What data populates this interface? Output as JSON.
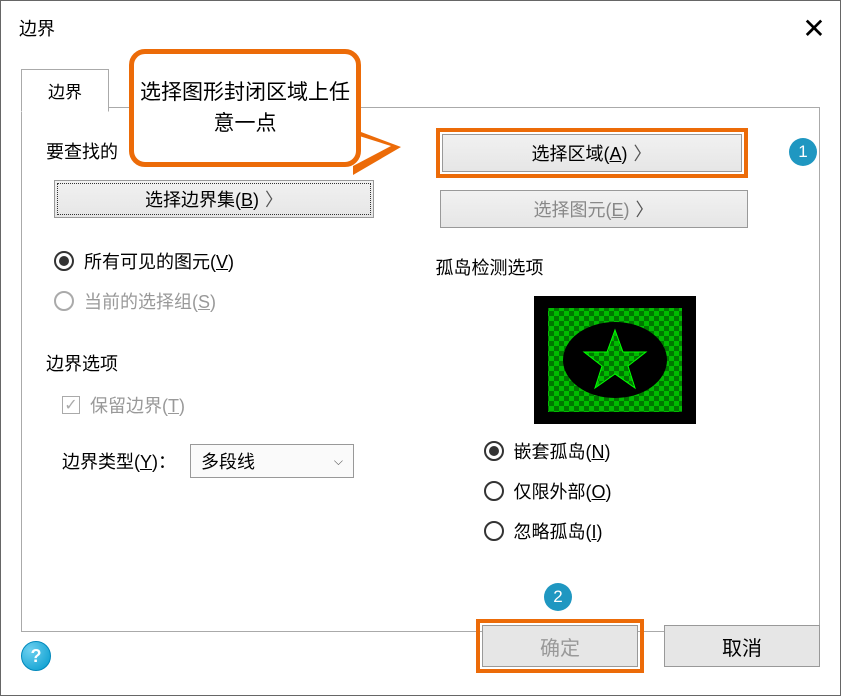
{
  "title": "边界",
  "tab_label": "边界",
  "callout_text": "选择图形封闭区域上任意一点",
  "left": {
    "header": "要查找的",
    "select_boundary_set": "选择边界集",
    "select_boundary_set_key": "B",
    "radio_all_visible": "所有可见的图元",
    "radio_all_visible_key": "V",
    "radio_current_sel": "当前的选择组",
    "radio_current_sel_key": "S",
    "boundary_options_header": "边界选项",
    "keep_boundary": "保留边界",
    "keep_boundary_key": "T",
    "boundary_type_label": "边界类型",
    "boundary_type_key": "Y",
    "boundary_type_value": "多段线"
  },
  "right": {
    "select_area": "选择区域",
    "select_area_key": "A",
    "select_entity": "选择图元",
    "select_entity_key": "E",
    "island_header": "孤岛检测选项",
    "radio_nested": "嵌套孤岛",
    "radio_nested_key": "N",
    "radio_outer": "仅限外部",
    "radio_outer_key": "O",
    "radio_ignore": "忽略孤岛",
    "radio_ignore_key": "I"
  },
  "footer": {
    "ok": "确定",
    "cancel": "取消"
  },
  "badge1": "1",
  "badge2": "2"
}
